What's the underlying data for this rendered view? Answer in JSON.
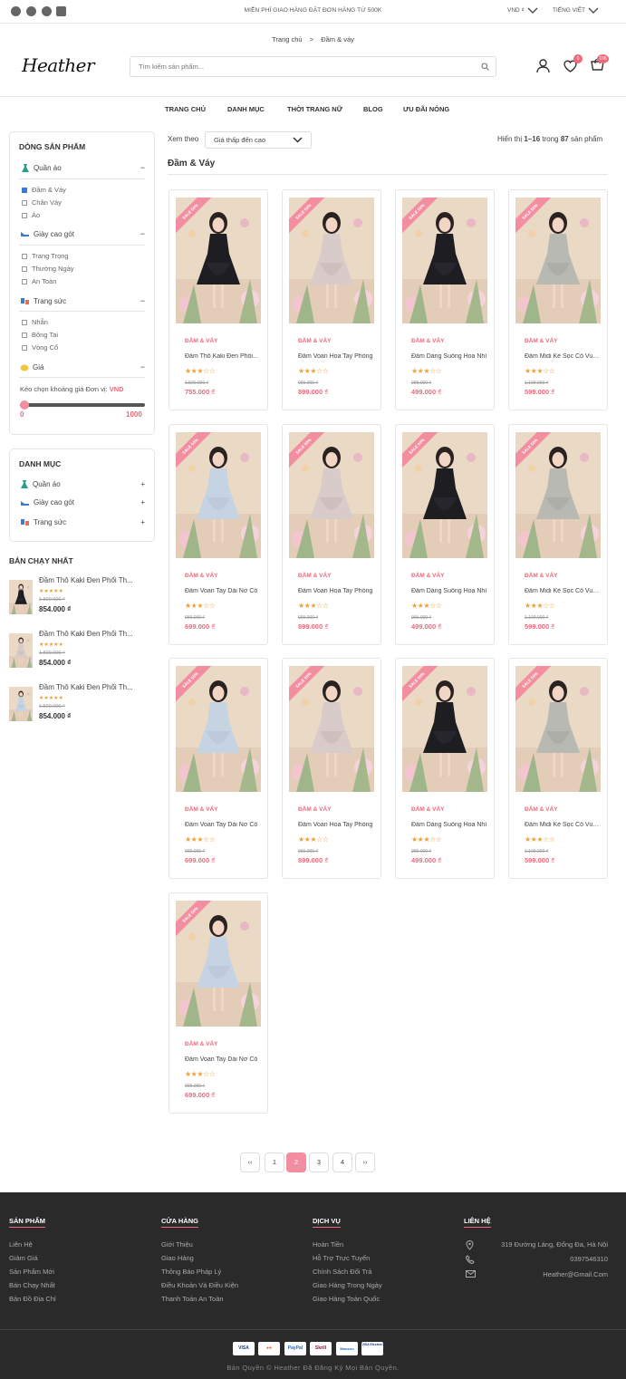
{
  "topbar": {
    "promo": "MIỄN PHÍ GIAO HÀNG ĐẶT ĐƠN HÀNG TỪ 500K",
    "currency": "VND ₫",
    "language": "TIẾNG VIỆT"
  },
  "breadcrumb": {
    "home": "Trang chủ",
    "sep": ">",
    "current": "Đầm & váy"
  },
  "header": {
    "logo": "Heather",
    "search_placeholder": "Tìm kiếm sản phẩm...",
    "wishlist_count": "0",
    "cart_count": "106"
  },
  "nav": [
    "TRANG CHỦ",
    "DANH MỤC",
    "THỜI TRANG NỮ",
    "BLOG",
    "ƯU ĐÃI NÓNG"
  ],
  "filters": {
    "title": "DÒNG SẢN PHẨM",
    "groups": [
      {
        "label": "Quần áo",
        "sign": "−",
        "items": [
          "Đầm & Váy",
          "Chân Váy",
          "Áo"
        ]
      },
      {
        "label": "Giày cao gót",
        "sign": "−",
        "items": [
          "Trang Trọng",
          "Thường Ngày",
          "An Toàn"
        ]
      },
      {
        "label": "Trang sức",
        "sign": "−",
        "items": [
          "Nhẫn",
          "Bông Tai",
          "Vòng Cổ"
        ]
      }
    ],
    "price_label": "Giá",
    "price_sign": "−",
    "price_text": "Kéo chọn khoảng giá Đơn vị:",
    "price_unit": "VND",
    "price_min": "0",
    "price_max": "1000"
  },
  "danhmuc": {
    "title": "DANH MỤC",
    "items": [
      {
        "label": "Quần áo",
        "sign": "+"
      },
      {
        "label": "Giày cao gót",
        "sign": "+"
      },
      {
        "label": "Trang sức",
        "sign": "+"
      }
    ]
  },
  "bestseller": {
    "title": "BÁN CHẠY NHẤT",
    "items": [
      {
        "name": "Đầm Thô Kaki Đen Phối Th...",
        "stars": "★★★★★",
        "old": "1.500.000 ₫",
        "price": "854.000 ₫"
      },
      {
        "name": "Đầm Thô Kaki Đen Phối Th...",
        "stars": "★★★★★",
        "old": "1.500.000 ₫",
        "price": "854.000 ₫"
      },
      {
        "name": "Đầm Thô Kaki Đen Phối Th...",
        "stars": "★★★★★",
        "old": "1.500.000 ₫",
        "price": "854.000 ₫"
      }
    ]
  },
  "toolbar": {
    "sort_label": "Xem theo",
    "sort_value": "Giá thấp đến cao",
    "showing_prefix": "Hiển thị",
    "showing_range": "1–16",
    "showing_mid": "trong",
    "showing_total": "87",
    "showing_suffix": "sản phẩm"
  },
  "section_title": "Đầm & Váy",
  "products": [
    {
      "ribbon": "SALE 50%",
      "tag": "ĐẦM & VÁY",
      "name": "Đầm Thô Kaki Đen Phối...",
      "stars": "★★★☆☆",
      "old": "1.500.000 ₫",
      "price": "755.000 ₫",
      "look": "black"
    },
    {
      "ribbon": "SALE 50%",
      "tag": "ĐẦM & VÁY",
      "name": "Đầm Voan Hoa Tay Phồng",
      "stars": "★★★☆☆",
      "old": "999.000 ₫",
      "price": "899.000 ₫",
      "look": "pinkgray"
    },
    {
      "ribbon": "SALE 50%",
      "tag": "ĐẦM & VÁY",
      "name": "Đầm Dáng Suông Hoa Nhí",
      "stars": "★★★☆☆",
      "old": "999.000 ₫",
      "price": "499.000 ₫",
      "look": "black"
    },
    {
      "ribbon": "SALE 50%",
      "tag": "ĐẦM & VÁY",
      "name": "Đầm Midi Kẻ Sọc Cổ Vuông",
      "stars": "★★★☆☆",
      "old": "1.199.000 ₫",
      "price": "599.000 ₫",
      "look": "gray"
    },
    {
      "ribbon": "SALE 50%",
      "tag": "ĐẦM & VÁY",
      "name": "Đầm Voan Tay Dài Nơ Cổ",
      "stars": "★★★☆☆",
      "old": "999.000 ₫",
      "price": "699.000 ₫",
      "look": "blue"
    },
    {
      "ribbon": "SALE 50%",
      "tag": "ĐẦM & VÁY",
      "name": "Đầm Voan Hoa Tay Phồng",
      "stars": "★★★☆☆",
      "old": "999.000 ₫",
      "price": "899.000 ₫",
      "look": "pinkgray"
    },
    {
      "ribbon": "SALE 50%",
      "tag": "ĐẦM & VÁY",
      "name": "Đầm Dáng Suông Hoa Nhí",
      "stars": "★★★☆☆",
      "old": "999.000 ₫",
      "price": "499.000 ₫",
      "look": "black"
    },
    {
      "ribbon": "SALE 50%",
      "tag": "ĐẦM & VÁY",
      "name": "Đầm Midi Kẻ Sọc Cổ Vuông",
      "stars": "★★★☆☆",
      "old": "1.199.000 ₫",
      "price": "599.000 ₫",
      "look": "gray"
    },
    {
      "ribbon": "SALE 50%",
      "tag": "ĐẦM & VÁY",
      "name": "Đầm Voan Tay Dài Nơ Cổ",
      "stars": "★★★☆☆",
      "old": "999.000 ₫",
      "price": "699.000 ₫",
      "look": "blue"
    },
    {
      "ribbon": "SALE 50%",
      "tag": "ĐẦM & VÁY",
      "name": "Đầm Voan Hoa Tay Phồng",
      "stars": "★★★☆☆",
      "old": "999.000 ₫",
      "price": "899.000 ₫",
      "look": "pinkgray"
    },
    {
      "ribbon": "SALE 50%",
      "tag": "ĐẦM & VÁY",
      "name": "Đầm Dáng Suông Hoa Nhí",
      "stars": "★★★☆☆",
      "old": "999.000 ₫",
      "price": "499.000 ₫",
      "look": "black"
    },
    {
      "ribbon": "SALE 50%",
      "tag": "ĐẦM & VÁY",
      "name": "Đầm Midi Kẻ Sọc Cổ Vuông",
      "stars": "★★★☆☆",
      "old": "1.199.000 ₫",
      "price": "599.000 ₫",
      "look": "gray"
    },
    {
      "ribbon": "SALE 50%",
      "tag": "ĐẦM & VÁY",
      "name": "Đầm Voan Tay Dài Nơ Cổ",
      "stars": "★★★☆☆",
      "old": "999.000 ₫",
      "price": "699.000 ₫",
      "look": "blue"
    }
  ],
  "pagination": {
    "prev": "‹‹",
    "pages": [
      "1",
      "2",
      "3",
      "4"
    ],
    "current": "2",
    "next": "››"
  },
  "footer": {
    "cols": [
      {
        "title": "SẢN PHẨM",
        "links": [
          "Liên Hệ",
          "Giảm Giá",
          "Sản Phẩm Mới",
          "Bán Chạy Nhất",
          "Bản Đồ Địa Chỉ"
        ]
      },
      {
        "title": "CỬA HÀNG",
        "links": [
          "Giới Thiệu",
          "Giao Hàng",
          "Thông Báo Pháp Lý",
          "Điều Khoản Và Điều Kiện",
          "Thanh Toán An Toàn"
        ]
      },
      {
        "title": "DỊCH VỤ",
        "links": [
          "Hoàn Tiền",
          "Hỗ Trợ Trực Tuyến",
          "Chính Sách Đổi Trả",
          "Giao Hàng Trong Ngày",
          "Giao Hàng Toàn Quốc"
        ]
      }
    ],
    "contact": {
      "title": "LIÊN HỆ",
      "address": "319 Đường Láng, Đống Đa, Hà Nội",
      "phone": "0397546310",
      "email": "Heather@Gmail.Com"
    },
    "payments": [
      "VISA",
      "●●",
      "PayPal",
      "Skrill",
      "Maestro",
      "VISA Electron"
    ],
    "copyright": "Bản Quyền © Heather Đã Đăng Ký Mọi Bản Quyền."
  },
  "colors": {
    "accent": "#f0677b",
    "ribbon": "#f28ea0",
    "star": "#e8a33d",
    "footer_bg": "#2b2a2a"
  }
}
